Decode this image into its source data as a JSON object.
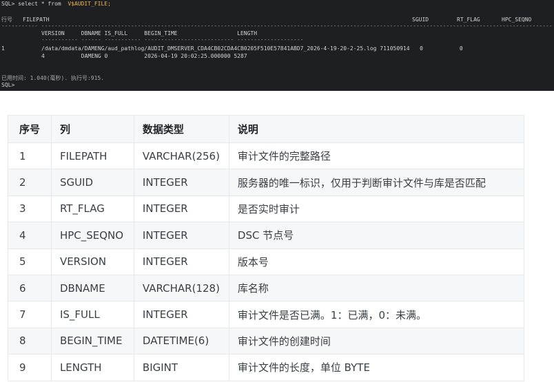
{
  "terminal": {
    "line1_prompt": "SQL> select * from  ",
    "line1_view": "V$AUDIT_FILE;",
    "header_rownum": "行号",
    "header_filepath": "FILEPATH",
    "header_sguid": "SGUID",
    "header_rt_flag": "RT_FLAG",
    "header_hpc_seqno": "HPC_SEQNO",
    "dash_line_top": "----------- -------------------------------------------------------------------------------------------------------------------------------------------------------------------------------------------------------------------",
    "sub_header": "VERSION     DBNAME IS_FULL     BEGIN_TIME                  LENGTH",
    "dash_line_sub": "----------- ------ ----------- --------------------------- --------------------",
    "row_num": "1",
    "row_path": "/data/dmdata/DAMENG/aud_pathlog/AUDIT_DMSERVER_CDA4CB02CDA4CB0205F510E57841ABD7_2026-4-19-20-2-25.log 711050914   0           0",
    "row_sub": "4           DAMENG 0           2026-04-19 20:02:25.000000 5287",
    "elapsed": "已用时间: 1.040(毫秒). 执行号:915.",
    "prompt_end": "SQL>"
  },
  "table": {
    "headers": [
      "序号",
      "列",
      "数据类型",
      "说明"
    ],
    "rows": [
      [
        "1",
        "FILEPATH",
        "VARCHAR(256)",
        "审计文件的完整路径"
      ],
      [
        "2",
        "SGUID",
        "INTEGER",
        "服务器的唯一标识，仅用于判断审计文件与库是否匹配"
      ],
      [
        "3",
        "RT_FLAG",
        "INTEGER",
        "是否实时审计"
      ],
      [
        "4",
        "HPC_SEQNO",
        "INTEGER",
        "DSC 节点号"
      ],
      [
        "5",
        "VERSION",
        "INTEGER",
        "版本号"
      ],
      [
        "6",
        "DBNAME",
        "VARCHAR(128)",
        "库名称"
      ],
      [
        "7",
        "IS_FULL",
        "INTEGER",
        "审计文件是否已满。1：已满，0：未满。"
      ],
      [
        "8",
        "BEGIN_TIME",
        "DATETIME(6)",
        "审计文件的创建时间"
      ],
      [
        "9",
        "LENGTH",
        "BIGINT",
        "审计文件的长度，单位 BYTE"
      ]
    ]
  },
  "colors": {
    "terminal_bg": "#1e1f22",
    "terminal_fg": "#d4d4d4",
    "view_highlight": "#e8b84a",
    "table_header_bg": "#f6f7f8",
    "table_border": "#e7e8ea"
  }
}
